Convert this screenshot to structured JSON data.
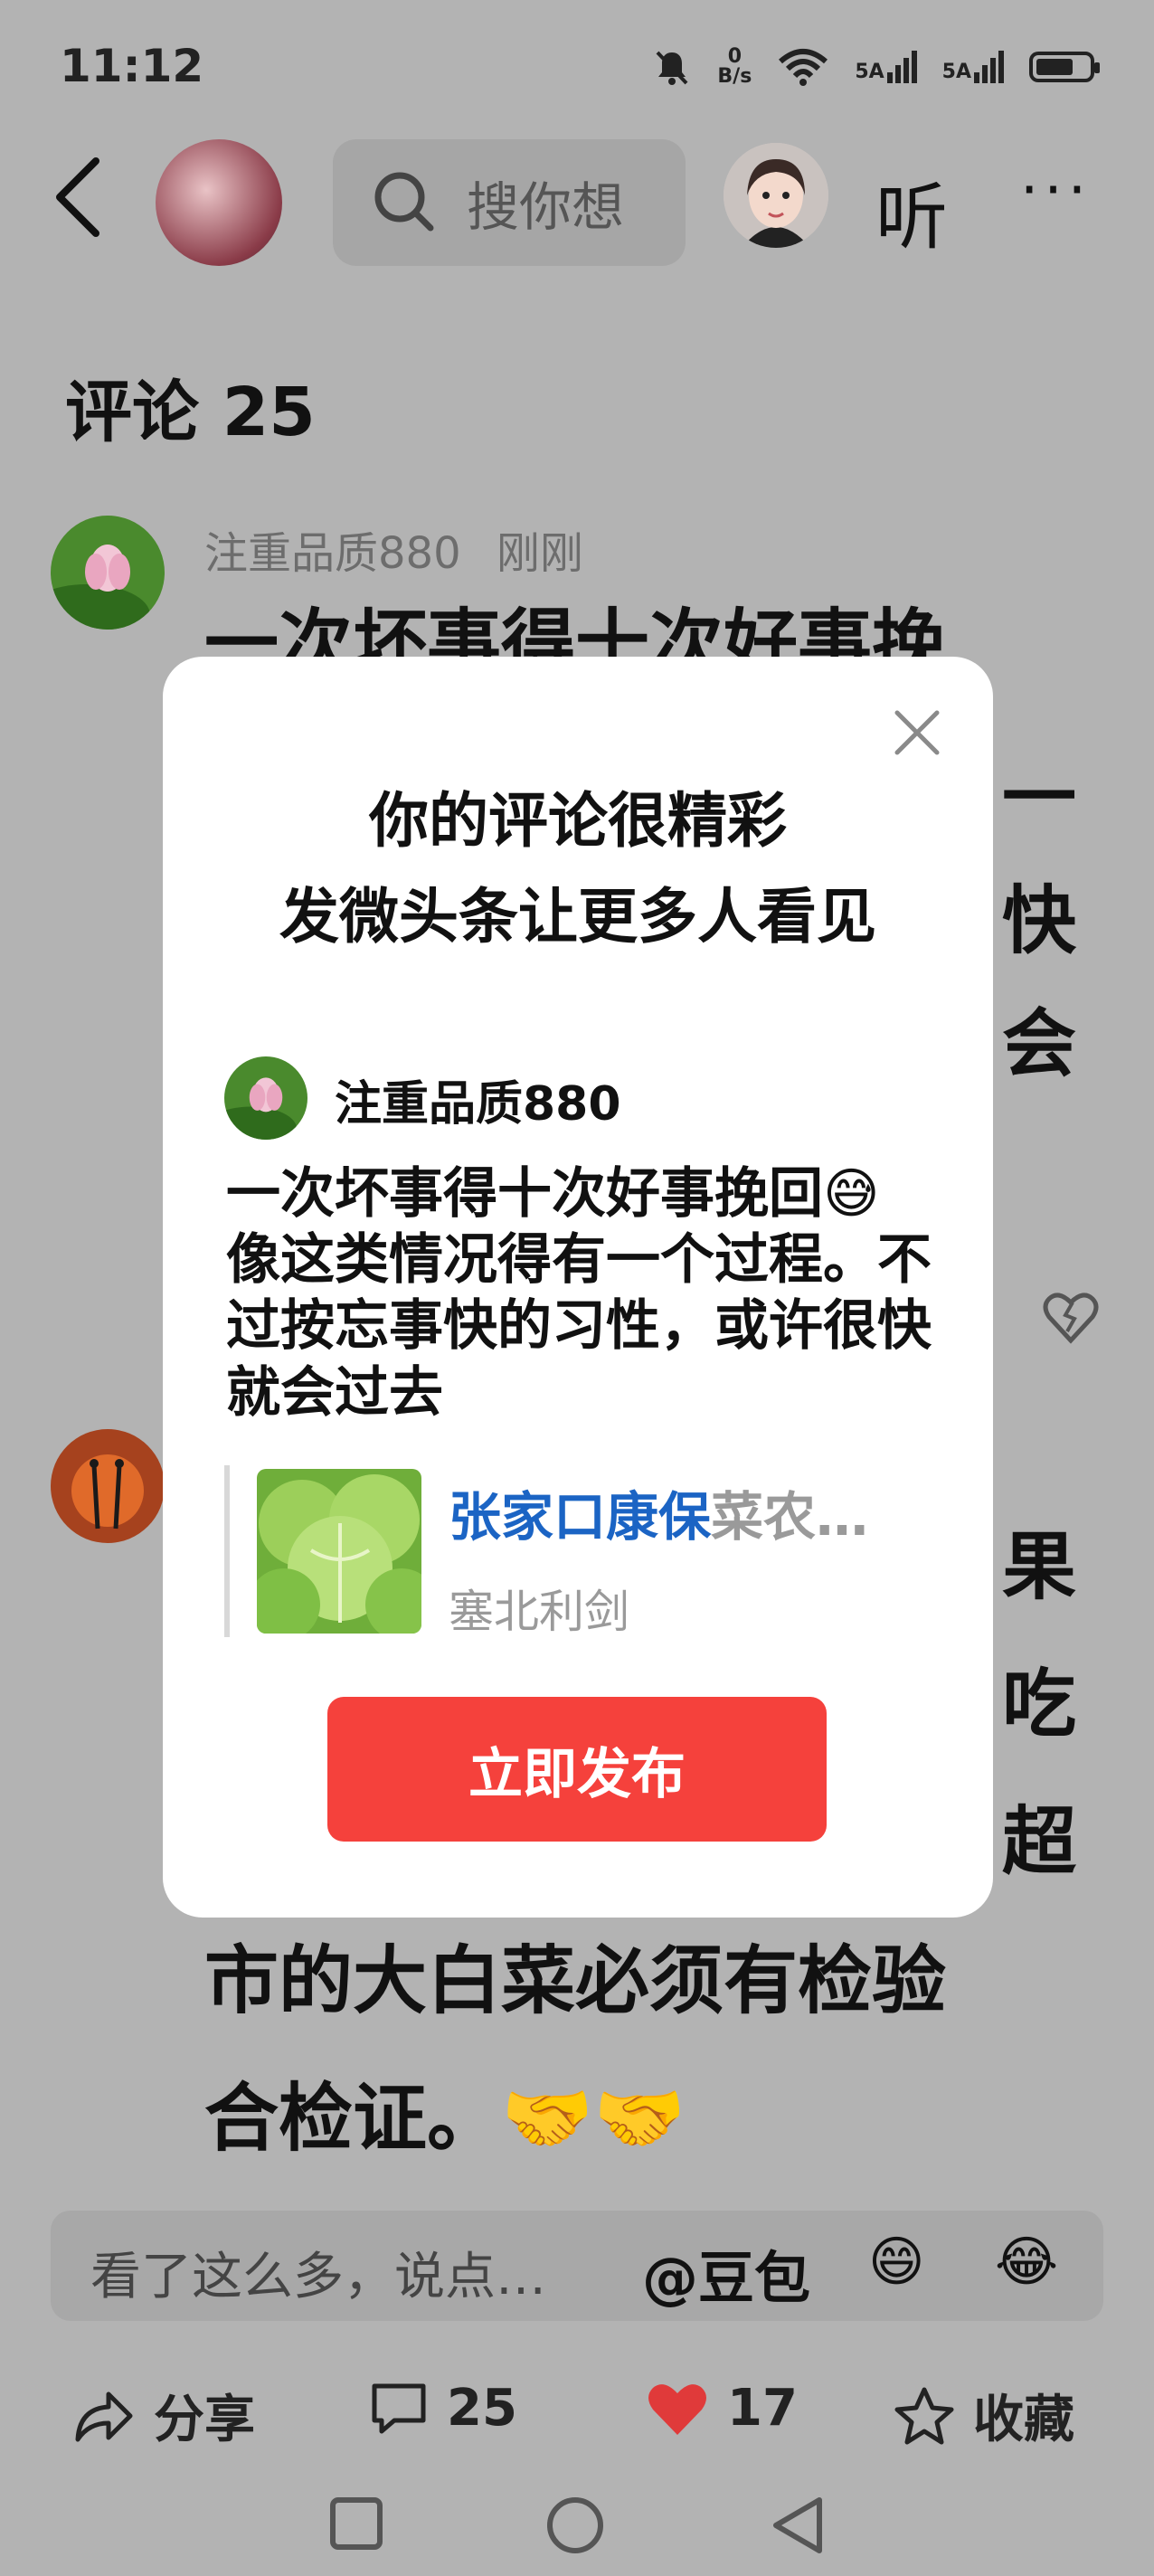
{
  "status_bar": {
    "time": "11:12",
    "net_speed": "0\nB/s",
    "signal1": "5A",
    "signal2": "5A"
  },
  "header": {
    "search_placeholder": "搜你想",
    "listen_label": "听",
    "more_label": "···"
  },
  "comments": {
    "title": "评论 25",
    "items": [
      {
        "username": "注重品质880",
        "time": "刚刚",
        "visible_line1": "一次坏事得十次好事挽",
        "partial_chars": [
          "一",
          "快",
          "会"
        ]
      },
      {
        "partial_chars": [
          "果",
          "吃",
          "超"
        ],
        "visible_line1": "市的大白菜必须有检验",
        "visible_line2": "合检证。🤝🤝"
      }
    ]
  },
  "modal": {
    "title_line1": "你的评论很精彩",
    "title_line2": "发微头条让更多人看见",
    "username": "注重品质880",
    "comment_text": "一次坏事得十次好事挽回😅像这类情况得有一个过程。不过按忘事快的习性，或许很快就会过去",
    "article_title_highlight": "张家口康保",
    "article_title_rest": "菜农…",
    "article_author": "塞北利剑",
    "publish_label": "立即发布"
  },
  "bottom": {
    "input_placeholder": "看了这么多，说点…",
    "mention_label": "@豆包",
    "emoji1": "😄",
    "emoji2": "😂",
    "share_label": "分享",
    "comment_count": "25",
    "like_count": "17",
    "collect_label": "收藏"
  }
}
